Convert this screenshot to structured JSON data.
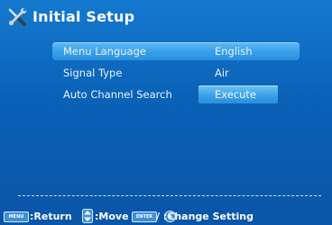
{
  "header": {
    "title": "Initial Setup",
    "icon": "tools-icon"
  },
  "menu": {
    "items": [
      {
        "label": "Menu Language",
        "value": "English"
      },
      {
        "label": "Signal Type",
        "value": "Air"
      },
      {
        "label": "Auto Channel Search",
        "value": "Execute"
      }
    ]
  },
  "footer": {
    "menu_key": "MENU",
    "return_text": ":Return",
    "move_text": ":Move",
    "enter_key": "ENTER",
    "change_text": "/ :Change Setting"
  },
  "colors": {
    "background": "#0a61b6",
    "highlight": "#3aa1ea",
    "text": "#ffffff"
  }
}
